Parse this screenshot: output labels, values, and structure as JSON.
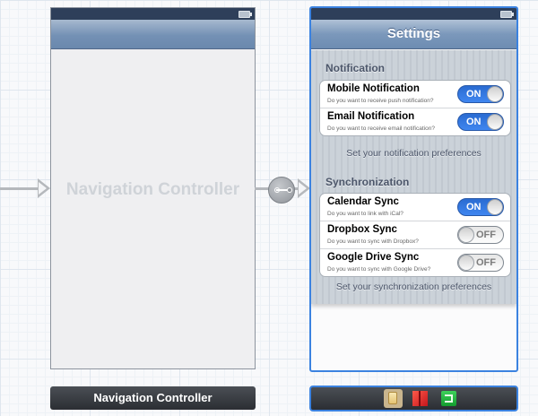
{
  "navigation_scene": {
    "placeholder": "Navigation Controller",
    "dock_label": "Navigation Controller"
  },
  "settings_scene": {
    "title": "Settings",
    "sections": [
      {
        "header": "Notification",
        "footer": "Set your notification preferences",
        "items": [
          {
            "title": "Mobile Notification",
            "subtitle": "Do you want to receive push notification?",
            "switch": "ON"
          },
          {
            "title": "Email Notification",
            "subtitle": "Do you want to receive email notification?",
            "switch": "ON"
          }
        ]
      },
      {
        "header": "Synchronization",
        "footer": "Set your synchronization preferences",
        "items": [
          {
            "title": "Calendar Sync",
            "subtitle": "Do you want to link with iCal?",
            "switch": "ON"
          },
          {
            "title": "Dropbox Sync",
            "subtitle": "Do you want to sync with Dropbox?",
            "switch": "OFF"
          },
          {
            "title": "Google Drive Sync",
            "subtitle": "Do you want to sync with Google Drive?",
            "switch": "OFF"
          }
        ]
      }
    ],
    "dock_icons": [
      "view-controller-icon",
      "first-responder-icon",
      "exit-icon"
    ]
  },
  "colors": {
    "selection": "#3b82e0",
    "switch_on": "#3f86f0",
    "nav_bar": "#7b98bb"
  }
}
